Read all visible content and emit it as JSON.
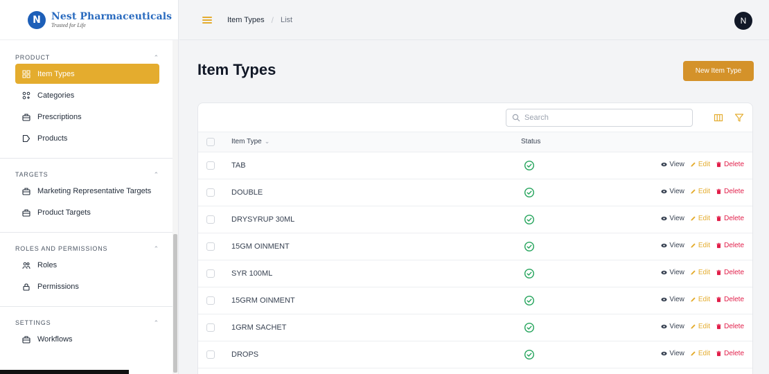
{
  "brand": {
    "name": "Nest Pharmaceuticals",
    "tagline": "Trusted for Life",
    "logo_letter": "N"
  },
  "sidebar": {
    "sections": [
      {
        "title": "PRODUCT",
        "items": [
          {
            "label": "Item Types",
            "icon": "grid-icon",
            "active": true
          },
          {
            "label": "Categories",
            "icon": "categories-icon"
          },
          {
            "label": "Prescriptions",
            "icon": "briefcase-icon"
          },
          {
            "label": "Products",
            "icon": "tag-icon"
          }
        ]
      },
      {
        "title": "TARGETS",
        "items": [
          {
            "label": "Marketing Representative Targets",
            "icon": "briefcase-icon"
          },
          {
            "label": "Product Targets",
            "icon": "briefcase-icon"
          }
        ]
      },
      {
        "title": "ROLES AND PERMISSIONS",
        "items": [
          {
            "label": "Roles",
            "icon": "users-icon"
          },
          {
            "label": "Permissions",
            "icon": "lock-icon"
          }
        ]
      },
      {
        "title": "SETTINGS",
        "items": [
          {
            "label": "Workflows",
            "icon": "briefcase-icon"
          }
        ]
      }
    ]
  },
  "topbar": {
    "breadcrumb": [
      "Item Types",
      "List"
    ],
    "avatar_letter": "N"
  },
  "page": {
    "title": "Item Types",
    "new_button_label": "New Item Type"
  },
  "table": {
    "search_placeholder": "Search",
    "columns": [
      "Item Type",
      "Status"
    ],
    "actions": {
      "view": "View",
      "edit": "Edit",
      "delete": "Delete"
    },
    "rows": [
      {
        "name": "TAB",
        "status": "active"
      },
      {
        "name": "DOUBLE",
        "status": "active"
      },
      {
        "name": "DRYSYRUP 30ML",
        "status": "active"
      },
      {
        "name": "15GM OINMENT",
        "status": "active"
      },
      {
        "name": "SYR 100ML",
        "status": "active"
      },
      {
        "name": "15GRM OINMENT",
        "status": "active"
      },
      {
        "name": "1GRM SACHET",
        "status": "active"
      },
      {
        "name": "DROPS",
        "status": "active"
      }
    ]
  },
  "colors": {
    "accent": "#e4ac2e",
    "button": "#d4922a",
    "status_active": "#22a35a",
    "delete": "#e11d48",
    "brand_blue": "#2a6bbf"
  }
}
